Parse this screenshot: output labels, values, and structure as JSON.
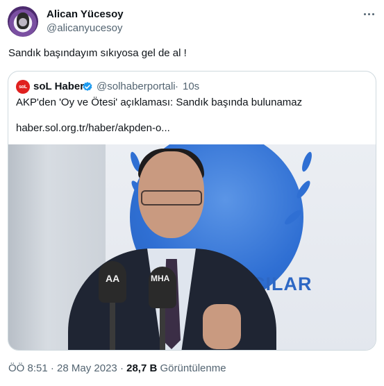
{
  "author": {
    "display_name": "Alican Yücesoy",
    "handle": "@alicanyucesoy"
  },
  "tweet": {
    "text": "Sandık başındayım sıkıyosa gel de al !"
  },
  "quote": {
    "avatar_text": "soL",
    "display_name": "soL Haber",
    "handle": "@solhaberportali",
    "separator": "·",
    "time": "10s",
    "text": "AKP'den 'Oy ve Ötesi' açıklaması: Sandık başında bulunamaz",
    "link": "haber.sol.org.tr/haber/akpden-o...",
    "image": {
      "banner_text": "CILAR",
      "mic_left_label": "AA",
      "mic_center_label": "MHA"
    }
  },
  "meta": {
    "time": "ÖÖ 8:51",
    "dot1": " · ",
    "date": "28 May 2023",
    "dot2": " · ",
    "views_count": "28,7 B",
    "views_label": " Görüntülenme"
  },
  "colors": {
    "text": "#0f1419",
    "secondary": "#536471",
    "border": "#cfd9de",
    "verified": "#1d9bf0",
    "sol_red": "#e0201f"
  }
}
